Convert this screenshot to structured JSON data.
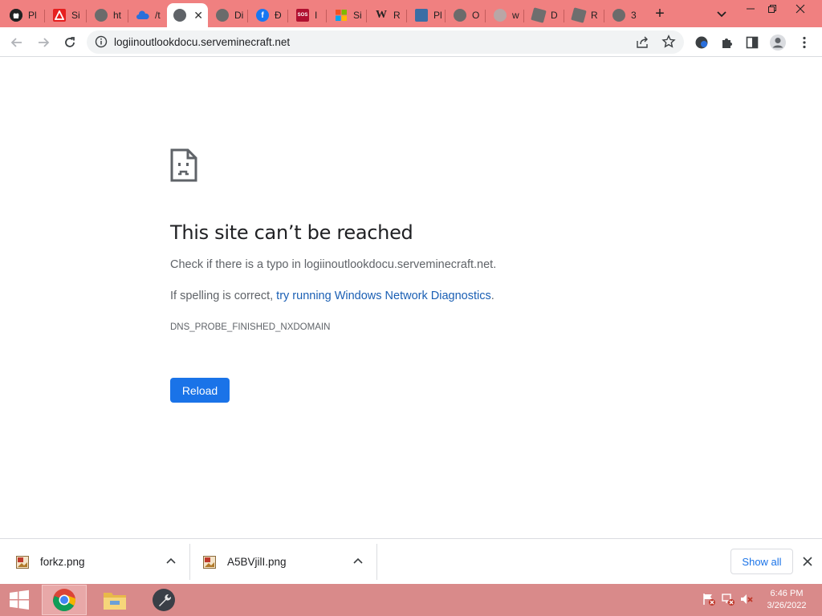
{
  "browser": {
    "tabs": [
      {
        "title": "Pl",
        "icon": "github-icon"
      },
      {
        "title": "Si",
        "icon": "adobe-icon"
      },
      {
        "title": "ht",
        "icon": "globe-icon"
      },
      {
        "title": "/t",
        "icon": "cloud-icon"
      },
      {
        "title": "",
        "icon": "globe-icon",
        "active": true
      },
      {
        "title": "Di",
        "icon": "globe-icon"
      },
      {
        "title": "Đ",
        "icon": "facebook-icon"
      },
      {
        "title": "I",
        "icon": "sos-icon"
      },
      {
        "title": "Si",
        "icon": "microsoft-icon"
      },
      {
        "title": "R",
        "icon": "wikipedia-icon"
      },
      {
        "title": "Pl",
        "icon": "image-icon"
      },
      {
        "title": "O",
        "icon": "globe-icon"
      },
      {
        "title": "w",
        "icon": "loading-icon"
      },
      {
        "title": "D",
        "icon": "roblox-icon"
      },
      {
        "title": "R",
        "icon": "roblox-icon"
      },
      {
        "title": "3",
        "icon": "globe-icon"
      }
    ],
    "new_tab_label": "+",
    "close_glyph": "✕",
    "url": "logiinoutlookdocu.serveminecraft.net"
  },
  "error_page": {
    "heading": "This site can’t be reached",
    "check_prefix": "Check if there is a typo in ",
    "check_domain": "logiinoutlookdocu.serveminecraft.net",
    "check_suffix": ".",
    "spelling_prefix": "If spelling is correct, ",
    "diagnostics_link": "try running Windows Network Diagnostics",
    "spelling_suffix": ".",
    "error_code": "DNS_PROBE_FINISHED_NXDOMAIN",
    "reload_label": "Reload"
  },
  "downloads": {
    "items": [
      {
        "filename": "forkz.png"
      },
      {
        "filename": "A5BVjilI.png"
      }
    ],
    "show_all_label": "Show all"
  },
  "taskbar": {
    "time": "6:46 PM",
    "date": "3/26/2022"
  },
  "colors": {
    "tabstrip": "#f08080",
    "accent": "#1a73e8",
    "link": "#1a5fb4",
    "taskbar": "#d98a8a"
  }
}
